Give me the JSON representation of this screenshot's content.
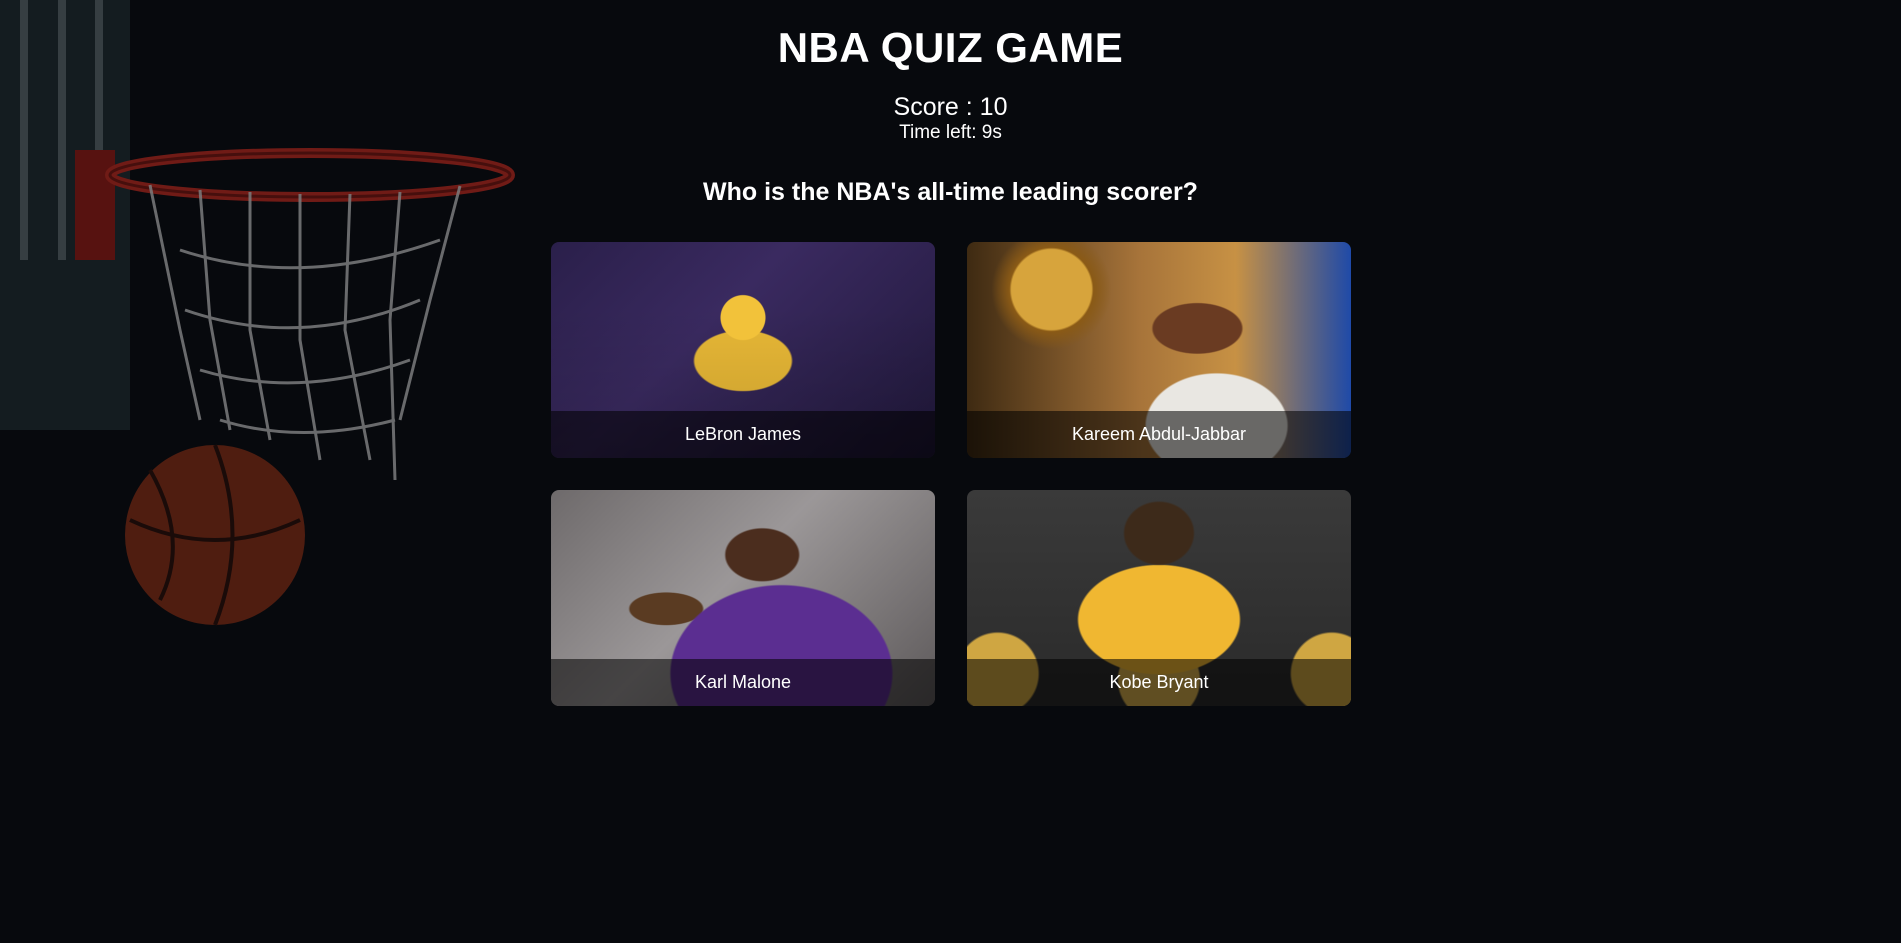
{
  "header": {
    "title": "NBA QUIZ GAME",
    "score": "Score : 10",
    "time_left": "Time left: 9s"
  },
  "quiz": {
    "question": "Who is the NBA's all-time leading scorer?",
    "options": [
      {
        "label": "LeBron James"
      },
      {
        "label": "Kareem Abdul-Jabbar"
      },
      {
        "label": "Karl Malone"
      },
      {
        "label": "Kobe Bryant"
      }
    ]
  },
  "colors": {
    "background": "#07090d",
    "text": "#ffffff",
    "label_overlay": "rgba(0,0,0,0.55)"
  }
}
